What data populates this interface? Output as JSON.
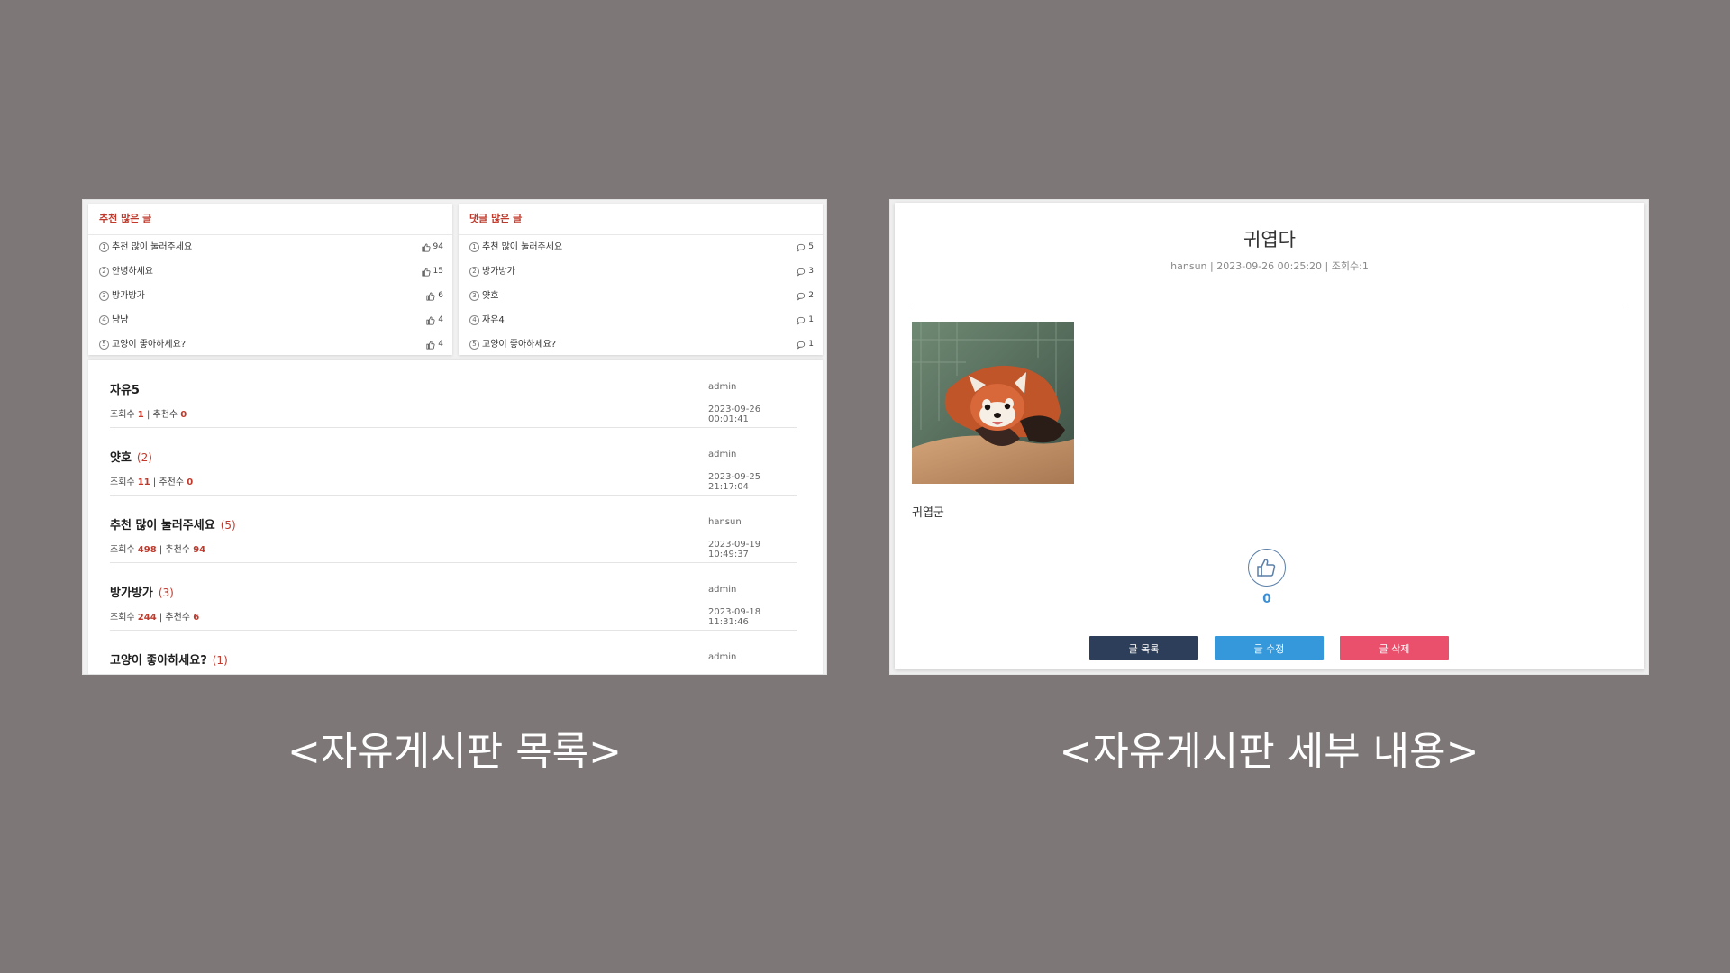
{
  "left": {
    "recommended_box": {
      "title": "추천 많은 글",
      "items": [
        {
          "rank": "1",
          "title": "추천 많이 눌러주세요",
          "count": "94"
        },
        {
          "rank": "2",
          "title": "안녕하세요",
          "count": "15"
        },
        {
          "rank": "3",
          "title": "방가방가",
          "count": "6"
        },
        {
          "rank": "4",
          "title": "냠냠",
          "count": "4"
        },
        {
          "rank": "5",
          "title": "고양이 좋아하세요?",
          "count": "4"
        }
      ]
    },
    "comment_box": {
      "title": "댓글 많은 글",
      "items": [
        {
          "rank": "1",
          "title": "추천 많이 눌러주세요",
          "count": "5"
        },
        {
          "rank": "2",
          "title": "방가방가",
          "count": "3"
        },
        {
          "rank": "3",
          "title": "얏호",
          "count": "2"
        },
        {
          "rank": "4",
          "title": "자유4",
          "count": "1"
        },
        {
          "rank": "5",
          "title": "고양이 좋아하세요?",
          "count": "1"
        }
      ]
    },
    "views_label": "조회수",
    "recs_label": "추천수",
    "posts": [
      {
        "title": "자유5",
        "comments": "",
        "views": "1",
        "recs": "0",
        "author": "admin",
        "date": "2023-09-26 00:01:41"
      },
      {
        "title": "얏호",
        "comments": "(2)",
        "views": "11",
        "recs": "0",
        "author": "admin",
        "date": "2023-09-25 21:17:04"
      },
      {
        "title": "추천 많이 눌러주세요",
        "comments": "(5)",
        "views": "498",
        "recs": "94",
        "author": "hansun",
        "date": "2023-09-19 10:49:37"
      },
      {
        "title": "방가방가",
        "comments": "(3)",
        "views": "244",
        "recs": "6",
        "author": "admin",
        "date": "2023-09-18 11:31:46"
      },
      {
        "title": "고양이 좋아하세요?",
        "comments": "(1)",
        "views": "",
        "recs": "",
        "author": "admin",
        "date": ""
      }
    ]
  },
  "right": {
    "title": "귀엽다",
    "meta": "hansun | 2023-09-26 00:25:20 | 조회수:1",
    "body": "귀엽군",
    "like_count": "0",
    "buttons": {
      "list": "글 목록",
      "edit": "글 수정",
      "delete": "글 삭제"
    },
    "photo_icon": "red-panda-photo",
    "like_icon": "thumbs-up-icon"
  },
  "captions": {
    "left": "<자유게시판 목록>",
    "right": "<자유게시판 세부 내용>"
  },
  "colors": {
    "background": "#7d7877",
    "accent_red": "#c0392b",
    "btn_list": "#2c3e5a",
    "btn_edit": "#3498db",
    "btn_delete": "#ea4f6c",
    "like_count": "#3b8fd6"
  }
}
